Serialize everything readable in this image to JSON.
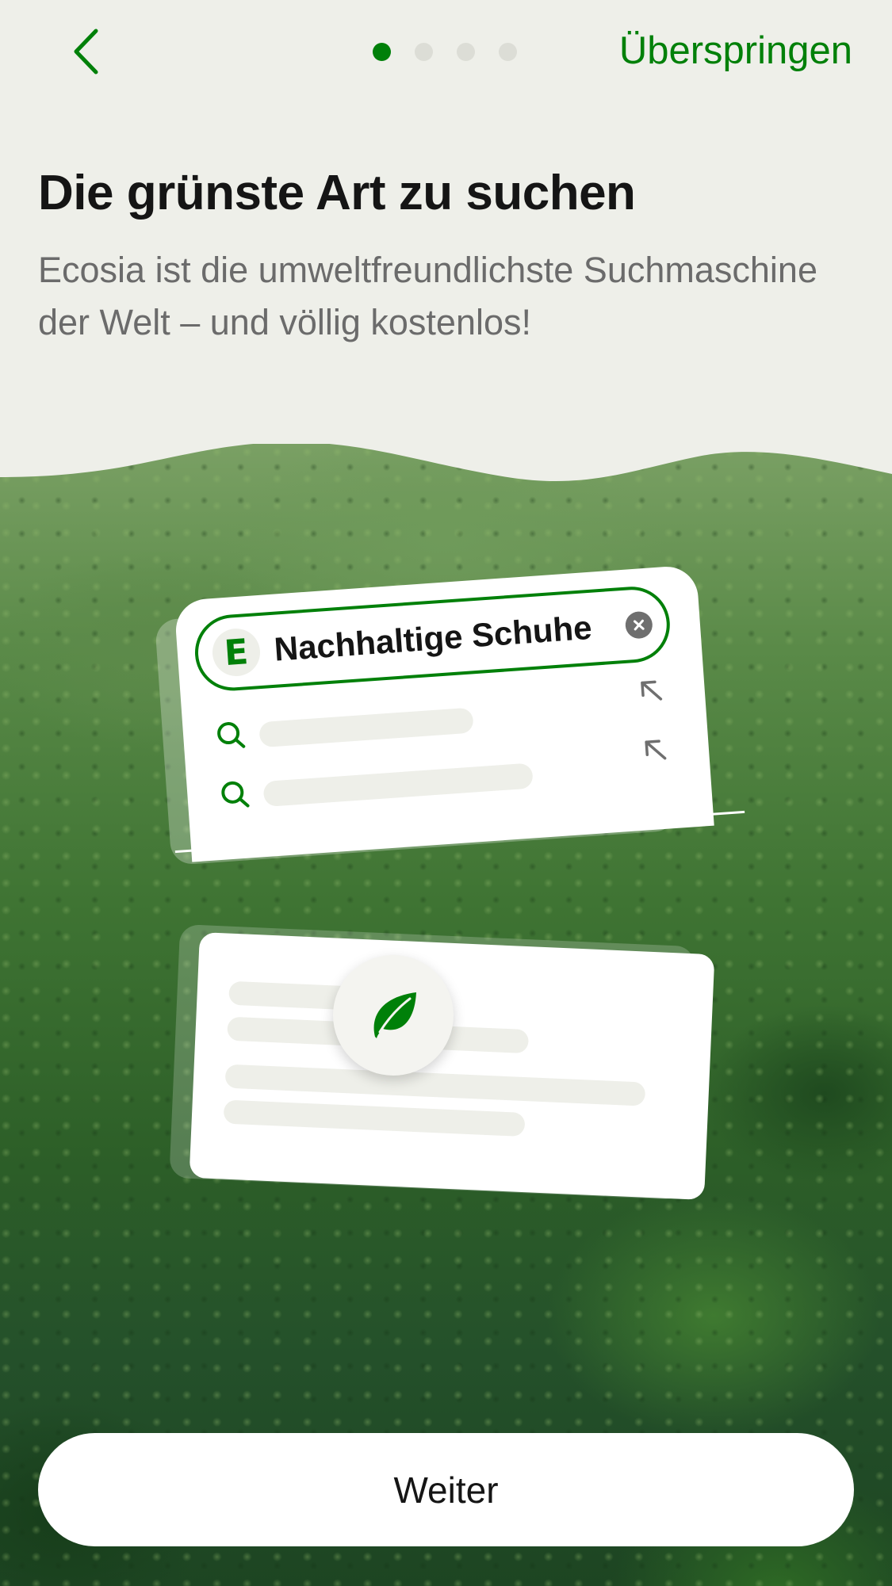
{
  "header": {
    "skip_label": "Überspringen",
    "pagination": {
      "total": 4,
      "current": 1
    }
  },
  "intro": {
    "title": "Die grünste Art zu suchen",
    "subtitle": "Ecosia ist die umweltfreundlichste Suchmaschine der Welt – und völlig kostenlos!"
  },
  "illustration": {
    "logo_letter": "E",
    "search_query": "Nachhaltige Schuhe",
    "icons": [
      "search-icon",
      "arrow-up-left-icon",
      "clear-icon",
      "leaf-icon"
    ]
  },
  "footer": {
    "continue_label": "Weiter"
  },
  "colors": {
    "accent": "#008009",
    "background": "#eeefe9",
    "text_primary": "#151515",
    "text_secondary": "#6b6b6b"
  }
}
